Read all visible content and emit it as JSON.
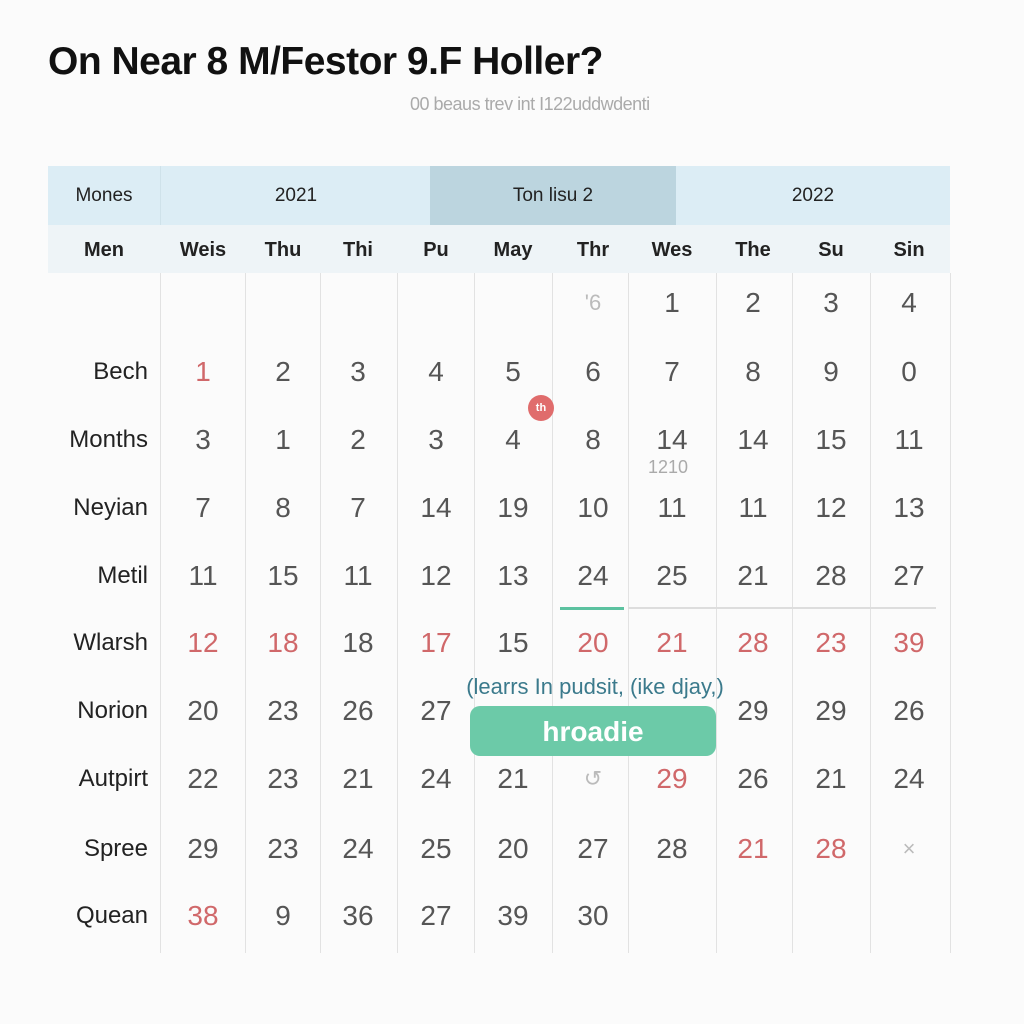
{
  "header": {
    "title": "On Near 8 M/Festor 9.F Holler?",
    "subtitle": "00 beaus trev int I122uddwdenti"
  },
  "group_header": {
    "label": "Mones",
    "groups": [
      "2021",
      "Ton lisu 2",
      "2022"
    ]
  },
  "columns": [
    "Men",
    "Weis",
    "Thu",
    "Thi",
    "Pu",
    "May",
    "Thr",
    "Wes",
    "The",
    "Su",
    "Sin"
  ],
  "rows": [
    {
      "label": "",
      "cells": [
        "",
        "",
        "",
        "",
        "",
        "'6",
        "1",
        "2",
        "3",
        "4"
      ],
      "red": [],
      "faded": [
        5
      ]
    },
    {
      "label": "Bech",
      "cells": [
        "1",
        "2",
        "3",
        "4",
        "5",
        "6",
        "7",
        "8",
        "9",
        "0"
      ],
      "red": [
        0
      ],
      "faded": []
    },
    {
      "label": "Months",
      "cells": [
        "3",
        "1",
        "2",
        "3",
        "4",
        "8",
        "14",
        "14",
        "15",
        "11"
      ],
      "red": [],
      "faded": []
    },
    {
      "label": "Neyian",
      "cells": [
        "7",
        "8",
        "7",
        "14",
        "19",
        "10",
        "11",
        "11",
        "12",
        "13"
      ],
      "red": [],
      "faded": []
    },
    {
      "label": "Metil",
      "cells": [
        "11",
        "15",
        "11",
        "12",
        "13",
        "24",
        "25",
        "21",
        "28",
        "27"
      ],
      "red": [],
      "faded": []
    },
    {
      "label": "Wlarsh",
      "cells": [
        "12",
        "18",
        "18",
        "17",
        "15",
        "20",
        "21",
        "28",
        "23",
        "39"
      ],
      "red": [
        0,
        1,
        3,
        5,
        6,
        7,
        8,
        9
      ],
      "faded": []
    },
    {
      "label": "Norion",
      "cells": [
        "20",
        "23",
        "26",
        "27",
        "",
        "",
        "",
        "29",
        "29",
        "26"
      ],
      "red": [],
      "faded": []
    },
    {
      "label": "Autpirt",
      "cells": [
        "22",
        "23",
        "21",
        "24",
        "21",
        "↺",
        "29",
        "26",
        "21",
        "24"
      ],
      "red": [
        6
      ],
      "faded": [
        5
      ]
    },
    {
      "label": "Spree",
      "cells": [
        "29",
        "23",
        "24",
        "25",
        "20",
        "27",
        "28",
        "21",
        "28",
        "×"
      ],
      "red": [
        7,
        8
      ],
      "faded": [
        9
      ]
    },
    {
      "label": "Quean",
      "cells": [
        "38",
        "9",
        "36",
        "27",
        "39",
        "30",
        "",
        "",
        "",
        ""
      ],
      "red": [
        0
      ],
      "faded": []
    }
  ],
  "cell_subtext": "1210",
  "badge": "th",
  "caption": "(learrs In pudsit, (ike djay,)",
  "button_label": "hroadie",
  "colors": {
    "header_bg": "#dcedf5",
    "header_highlight": "#bcd5df",
    "accent_green": "#6ccaa8",
    "weekend_red": "#d0686a",
    "caption": "#3b7a8c"
  }
}
